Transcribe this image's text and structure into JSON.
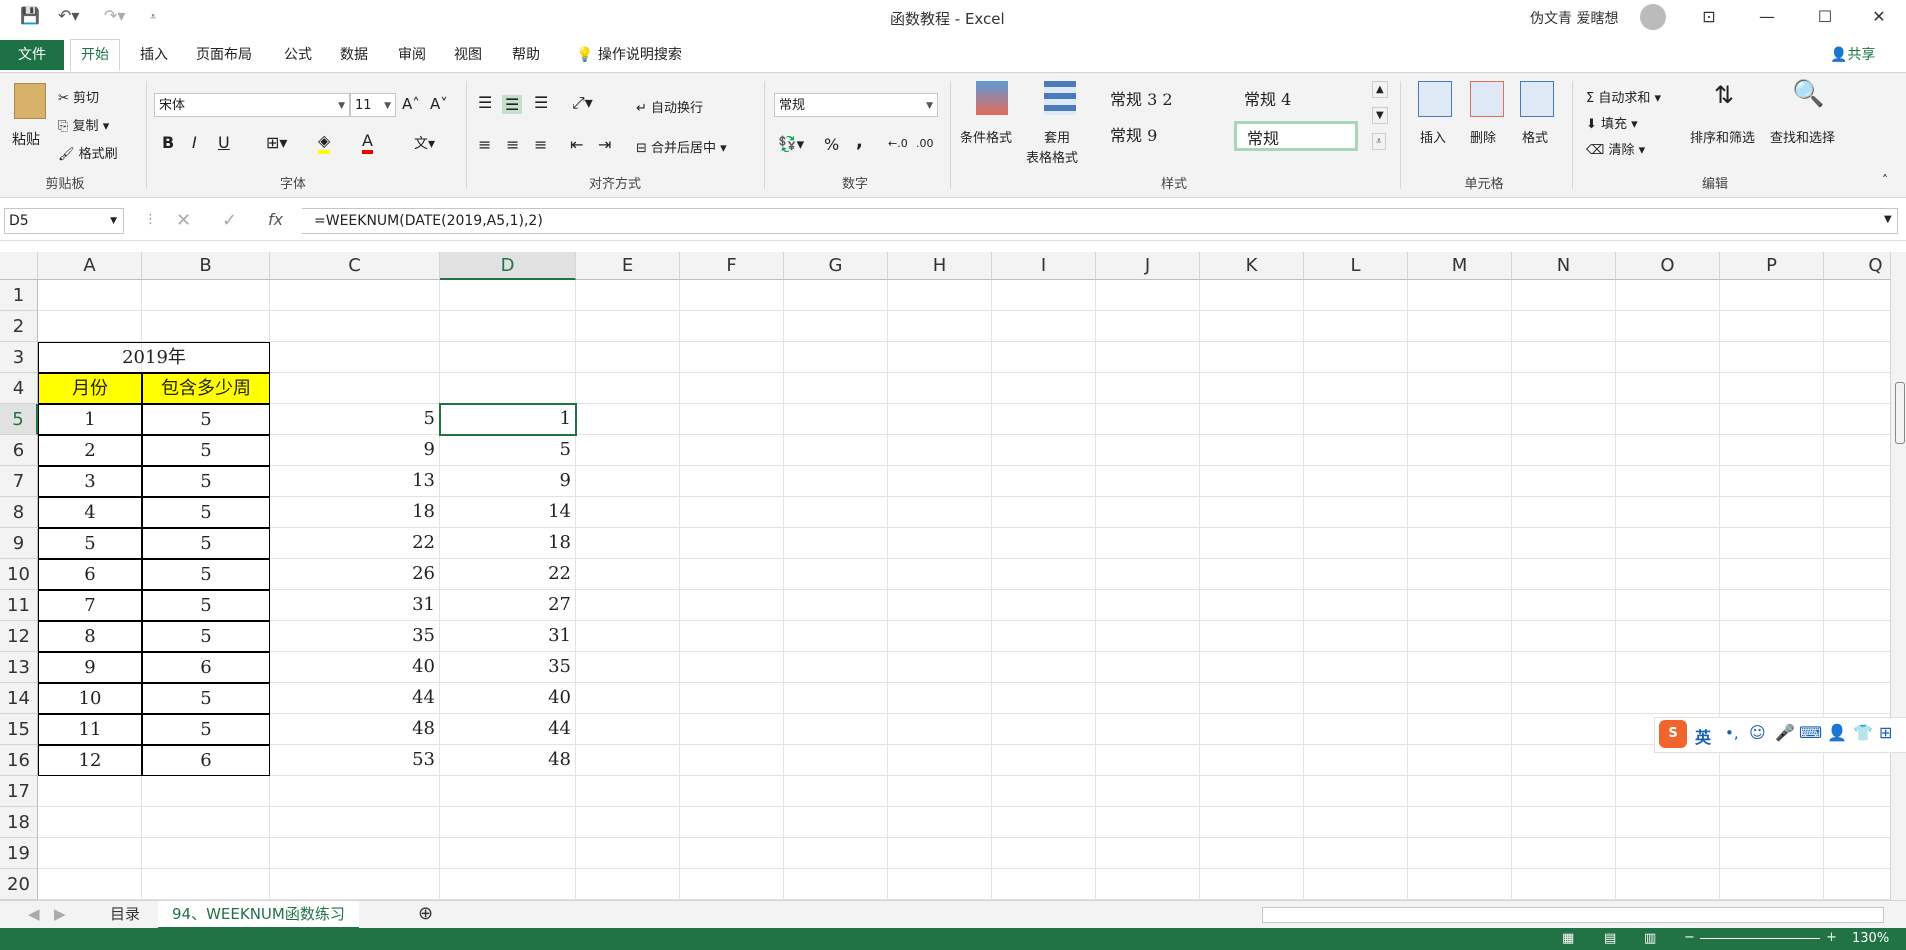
{
  "window": {
    "title": "函数教程  -  Excel",
    "user": "伪文青 爱瞎想"
  },
  "tabs": [
    "文件",
    "开始",
    "插入",
    "页面布局",
    "公式",
    "数据",
    "审阅",
    "视图",
    "帮助"
  ],
  "search_label": "操作说明搜索",
  "share_label": "共享",
  "ribbon": {
    "clipboard": {
      "paste": "粘贴",
      "cut": "剪切",
      "copy": "复制",
      "format_painter": "格式刷",
      "label": "剪贴板"
    },
    "font": {
      "name": "宋体",
      "size": "11",
      "bold": "B",
      "italic": "I",
      "underline": "U",
      "label": "字体"
    },
    "alignment": {
      "wrap": "自动换行",
      "merge": "合并后居中",
      "label": "对齐方式"
    },
    "number": {
      "format": "常规",
      "percent": "%",
      "comma": ",",
      "label": "数字"
    },
    "styles": {
      "conditional": "条件格式",
      "table_1": "套用",
      "table_2": "表格格式",
      "cells": [
        "常规 3 2",
        "常规 4",
        "常规 9",
        "常规"
      ],
      "label": "样式"
    },
    "cells": {
      "insert": "插入",
      "delete": "删除",
      "format": "格式",
      "label": "单元格"
    },
    "editing": {
      "autosum": "自动求和",
      "fill": "填充",
      "clear": "清除",
      "sort": "排序和筛选",
      "find": "查找和选择",
      "label": "编辑"
    }
  },
  "formula_bar": {
    "name_box": "D5",
    "fx": "fx",
    "formula": "=WEEKNUM(DATE(2019,A5,1),2)"
  },
  "columns": [
    "A",
    "B",
    "C",
    "D",
    "E",
    "F",
    "G",
    "H",
    "I",
    "J",
    "K",
    "L",
    "M",
    "N",
    "O",
    "P",
    "Q"
  ],
  "rows": [
    "1",
    "2",
    "3",
    "4",
    "5",
    "6",
    "7",
    "8",
    "9",
    "10",
    "11",
    "12",
    "13",
    "14",
    "15",
    "16",
    "17",
    "18",
    "19",
    "20"
  ],
  "table": {
    "title": "2019年",
    "headers": [
      "月份",
      "包含多少周"
    ],
    "data": [
      [
        "1",
        "5",
        "5",
        "1"
      ],
      [
        "2",
        "5",
        "9",
        "5"
      ],
      [
        "3",
        "5",
        "13",
        "9"
      ],
      [
        "4",
        "5",
        "18",
        "14"
      ],
      [
        "5",
        "5",
        "22",
        "18"
      ],
      [
        "6",
        "5",
        "26",
        "22"
      ],
      [
        "7",
        "5",
        "31",
        "27"
      ],
      [
        "8",
        "5",
        "35",
        "31"
      ],
      [
        "9",
        "6",
        "40",
        "35"
      ],
      [
        "10",
        "5",
        "44",
        "40"
      ],
      [
        "11",
        "5",
        "48",
        "44"
      ],
      [
        "12",
        "6",
        "53",
        "48"
      ]
    ]
  },
  "sheets": [
    "目录",
    "94、WEEKNUM函数练习"
  ],
  "status": {
    "zoom": "130%"
  },
  "ime": {
    "label": "英"
  },
  "colors": {
    "accent": "#217346",
    "header_fill": "#ffff00"
  }
}
